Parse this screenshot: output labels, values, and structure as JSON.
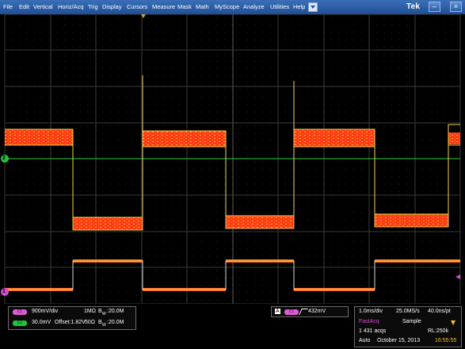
{
  "menu": {
    "items": [
      "File",
      "Edit",
      "Vertical",
      "Horiz/Acq",
      "Trig",
      "Display",
      "Cursors",
      "Measure",
      "Mask",
      "Math",
      "MyScope",
      "Analyze",
      "Utilities",
      "Help"
    ],
    "brand": "Tek"
  },
  "channels": {
    "ch1": {
      "scale": "900mV/div",
      "coupling": "1MΩ",
      "bw_prefix": "B",
      "bw_sub": "W",
      "bw_value": ":20.0M",
      "color": "#e05ad6"
    },
    "ch2": {
      "scale": "30.0mV",
      "offset": "Offset:1.82V",
      "coupling": "50Ω",
      "bw_prefix": "B",
      "bw_sub": "W",
      "bw_value": ":20.0M",
      "color": "#23c23d"
    }
  },
  "trigger": {
    "box": "A",
    "value": "432mV"
  },
  "acquisition": {
    "timebase": "1.0ms/div",
    "sample_rate": "25.0MS/s",
    "resolution": "40.0ns/pt",
    "mode": "FastAcq",
    "sample": "Sample",
    "acqs": "1 431 acqs",
    "record_length": "RL:250k",
    "run_mode": "Auto",
    "date": "October 15, 2013",
    "time": "16:55:55"
  },
  "markers": {
    "ch2": "2",
    "ch1": "1"
  },
  "colors": {
    "accent": "#1f4f96",
    "trace_fill": "#ff3b16",
    "trace_edge": "#f2d14e",
    "green": "#23c23d",
    "magenta": "#e05ad6"
  }
}
